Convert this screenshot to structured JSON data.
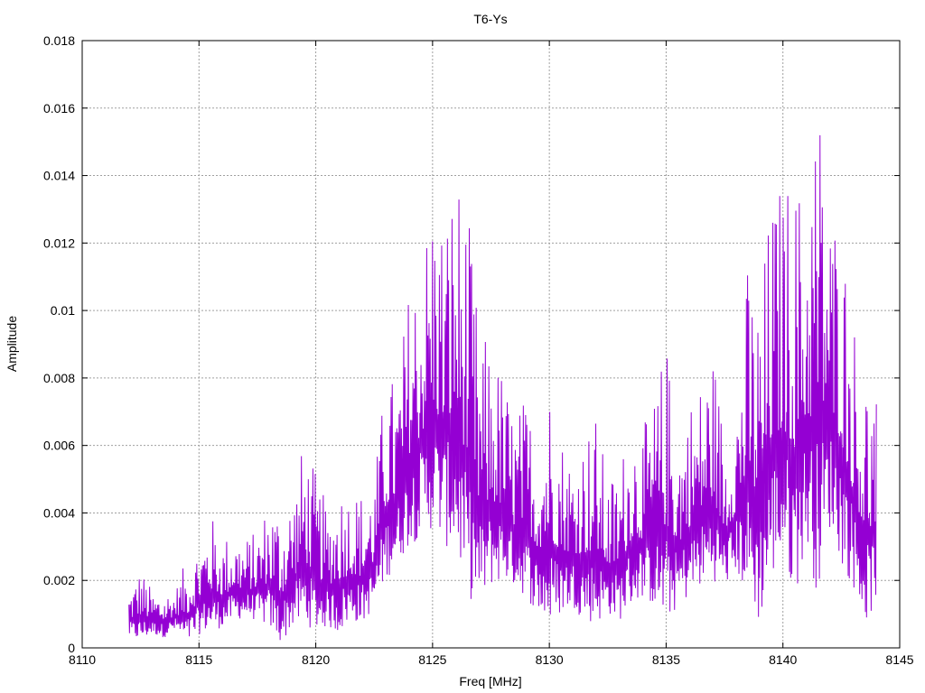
{
  "chart_data": {
    "type": "line",
    "title": "T6-Ys",
    "xlabel": "Freq [MHz]",
    "ylabel": "Amplitude",
    "xlim": [
      8110,
      8145
    ],
    "ylim": [
      0,
      0.018
    ],
    "x_ticks": [
      "8110",
      "8115",
      "8120",
      "8125",
      "8130",
      "8135",
      "8140",
      "8145"
    ],
    "y_ticks": [
      "0",
      "0.002",
      "0.004",
      "0.006",
      "0.008",
      "0.01",
      "0.012",
      "0.014",
      "0.016",
      "0.018"
    ],
    "grid": true,
    "line_color": "#9400d3",
    "series": [
      {
        "name": "",
        "x": [
          8112.0,
          8112.5,
          8113.0,
          8113.5,
          8114.0,
          8114.5,
          8115.0,
          8115.5,
          8116.0,
          8116.5,
          8117.0,
          8117.5,
          8118.0,
          8118.5,
          8119.0,
          8119.5,
          8120.0,
          8120.5,
          8121.0,
          8121.5,
          8122.0,
          8122.5,
          8123.0,
          8123.5,
          8124.0,
          8124.5,
          8125.0,
          8125.5,
          8126.0,
          8126.5,
          8127.0,
          8127.5,
          8128.0,
          8128.5,
          8129.0,
          8129.5,
          8130.0,
          8130.5,
          8131.0,
          8131.5,
          8132.0,
          8132.5,
          8133.0,
          8133.5,
          8134.0,
          8134.5,
          8135.0,
          8135.5,
          8136.0,
          8136.5,
          8137.0,
          8137.5,
          8138.0,
          8138.5,
          8139.0,
          8139.5,
          8140.0,
          8140.5,
          8141.0,
          8141.5,
          8142.0,
          8142.5,
          8143.0,
          8143.5,
          8144.0
        ],
        "low": [
          0.0003,
          0.0002,
          0.0004,
          0.0003,
          0.0005,
          0.0001,
          0.0004,
          0.0005,
          0.0006,
          0.0008,
          0.0009,
          0.0008,
          0.0006,
          0.0001,
          0.0006,
          0.0007,
          0.0005,
          0.0006,
          0.0004,
          0.0008,
          0.0007,
          0.0012,
          0.002,
          0.0025,
          0.003,
          0.0033,
          0.0035,
          0.003,
          0.0028,
          0.0015,
          0.0012,
          0.0018,
          0.002,
          0.0018,
          0.0015,
          0.001,
          0.0006,
          0.001,
          0.0012,
          0.0008,
          0.0007,
          0.001,
          0.0008,
          0.0012,
          0.0015,
          0.0012,
          0.0007,
          0.0012,
          0.0015,
          0.0018,
          0.002,
          0.0018,
          0.0022,
          0.0015,
          0.0007,
          0.002,
          0.0025,
          0.0015,
          0.003,
          0.0015,
          0.0035,
          0.0025,
          0.0018,
          0.0007,
          0.0013
        ],
        "high": [
          0.0018,
          0.0024,
          0.0017,
          0.0017,
          0.0018,
          0.0027,
          0.0032,
          0.004,
          0.0033,
          0.0035,
          0.0033,
          0.0035,
          0.0045,
          0.0043,
          0.0047,
          0.0062,
          0.0052,
          0.0042,
          0.005,
          0.0048,
          0.0047,
          0.005,
          0.0082,
          0.008,
          0.0109,
          0.0118,
          0.0138,
          0.013,
          0.0145,
          0.0131,
          0.0095,
          0.009,
          0.0083,
          0.007,
          0.0075,
          0.0065,
          0.008,
          0.0065,
          0.0058,
          0.0065,
          0.007,
          0.005,
          0.0055,
          0.007,
          0.0065,
          0.0075,
          0.0092,
          0.0065,
          0.0075,
          0.008,
          0.009,
          0.0065,
          0.0075,
          0.0115,
          0.0105,
          0.0135,
          0.014,
          0.0142,
          0.0135,
          0.0171,
          0.0133,
          0.0129,
          0.01,
          0.0085,
          0.0077
        ]
      }
    ]
  }
}
